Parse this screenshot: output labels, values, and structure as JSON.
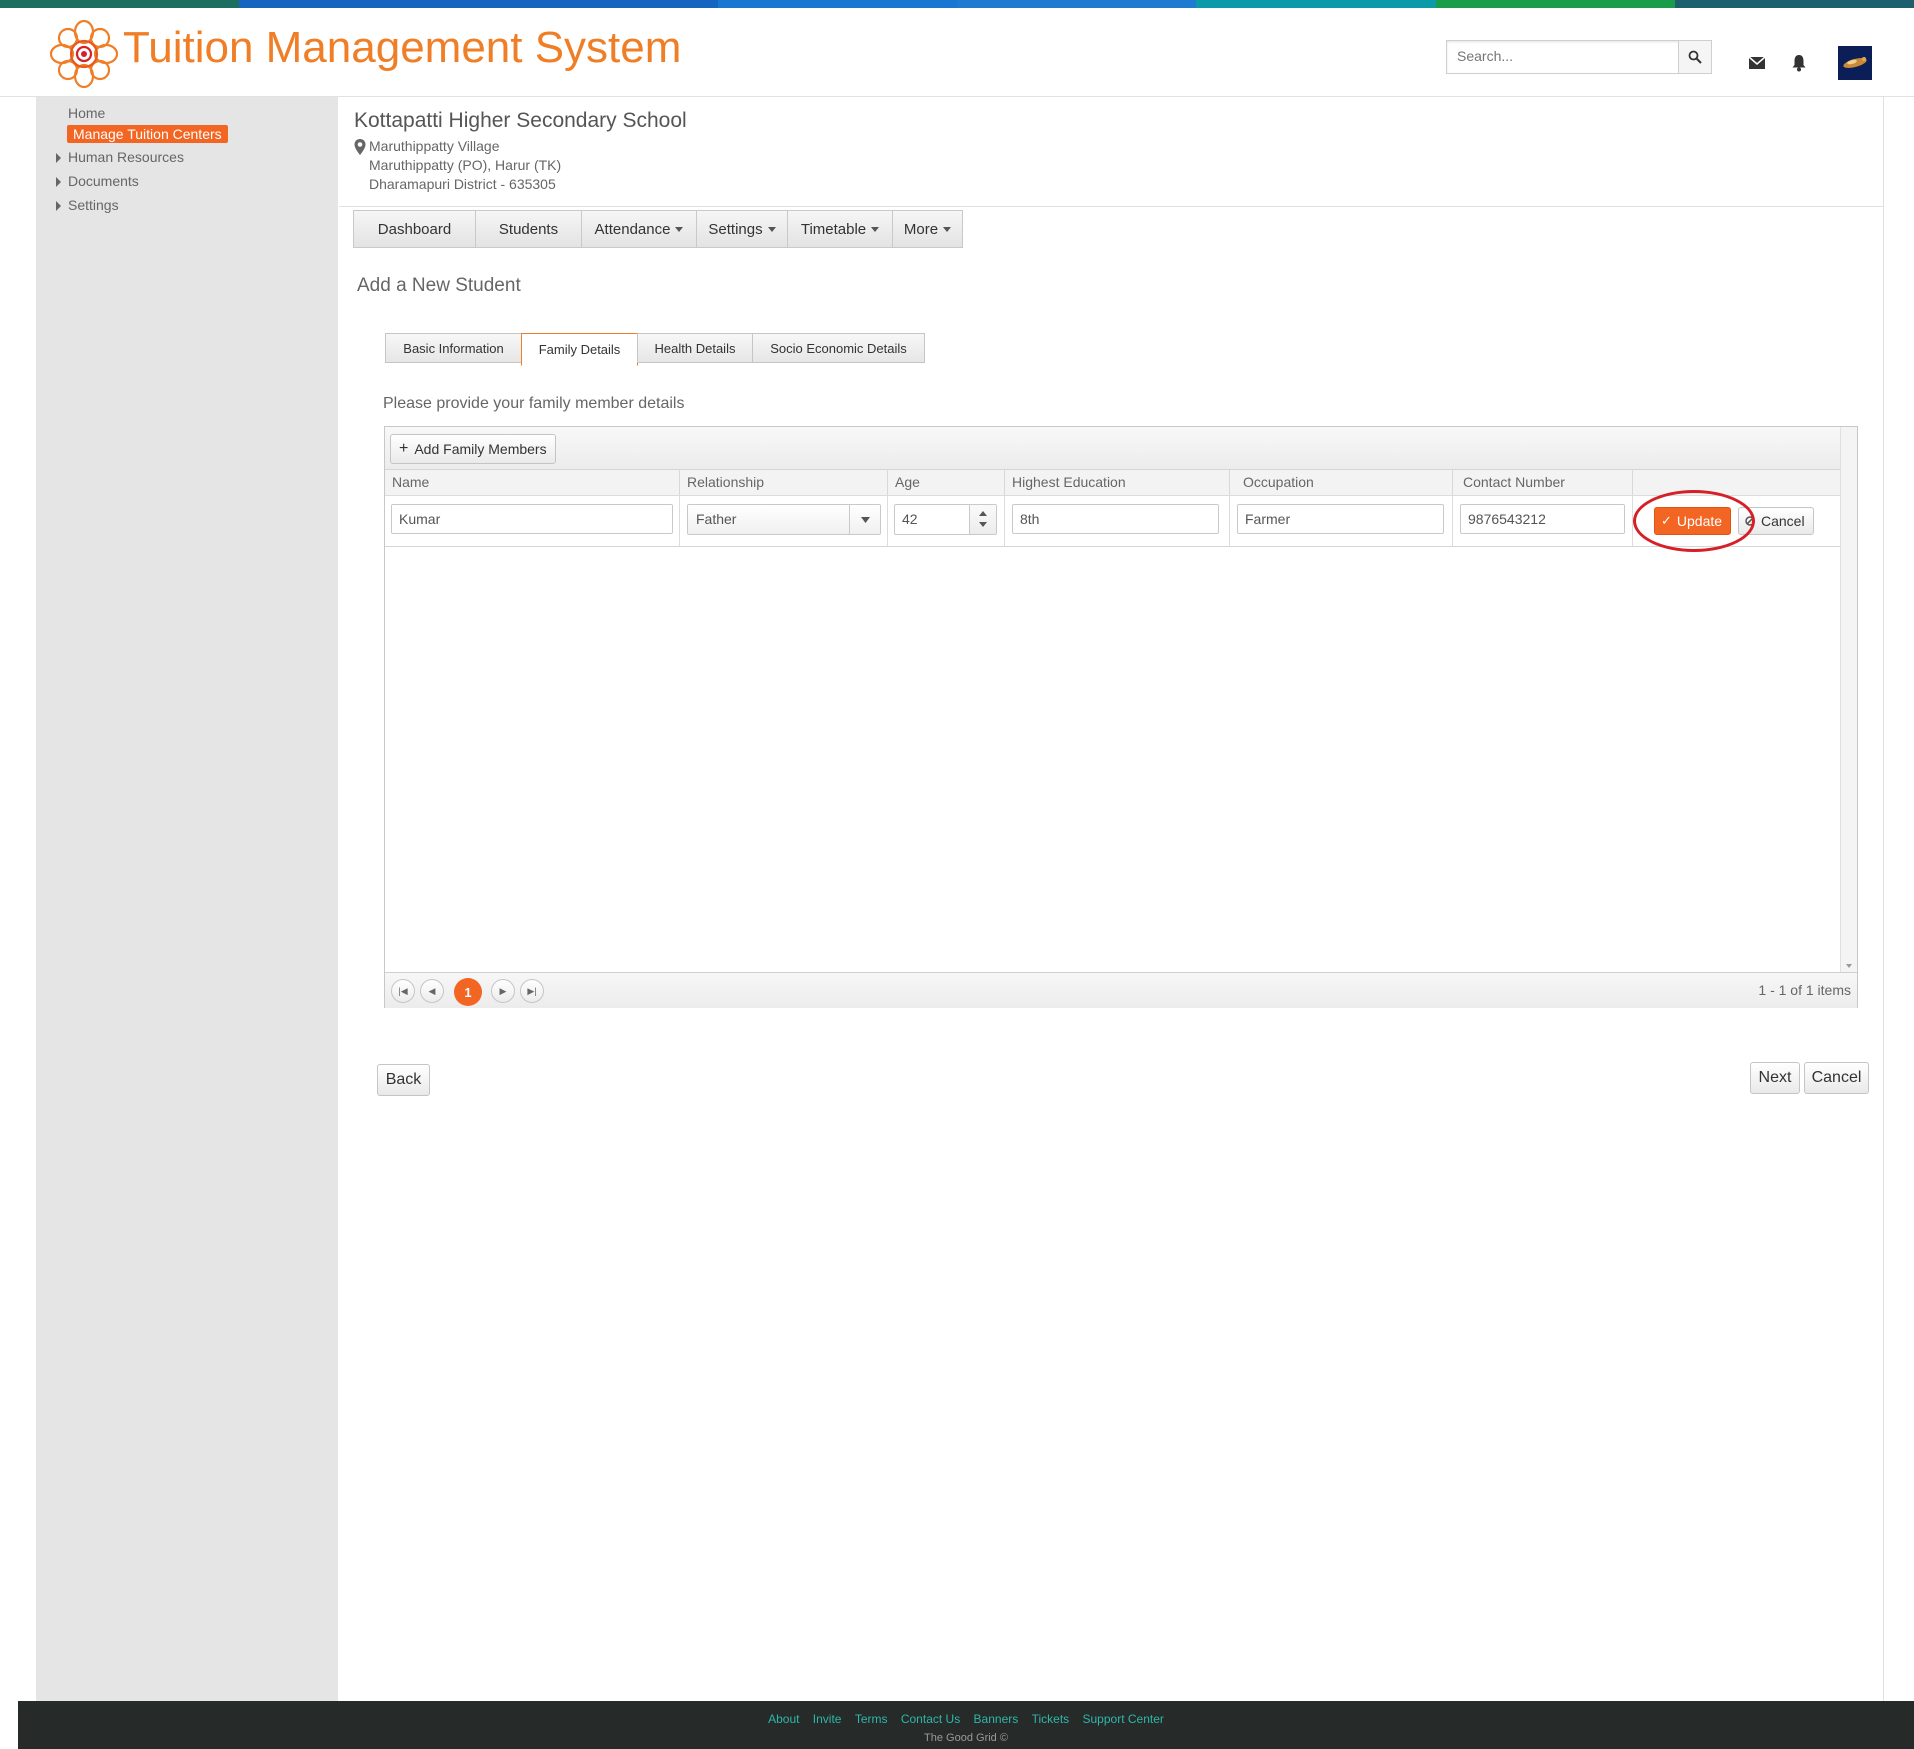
{
  "colors": {
    "accent": "#f26522",
    "title": "#f07e26",
    "stripe": [
      "#1b6e60",
      "#1565c0",
      "#1565c0",
      "#1976d2",
      "#1f7bd0",
      "#0c9aa8",
      "#1a9d4a",
      "#1d5f6e"
    ]
  },
  "header": {
    "app_title": "Tuition Management System",
    "search_placeholder": "Search...",
    "icons": [
      "search-icon",
      "mail-icon",
      "bell-icon",
      "avatar"
    ]
  },
  "sidebar": {
    "items": [
      {
        "label": "Home",
        "expandable": false,
        "active": false
      },
      {
        "label": "Manage Tuition  Centers",
        "expandable": false,
        "active": true
      },
      {
        "label": "Human Resources",
        "expandable": true,
        "active": false
      },
      {
        "label": "Documents",
        "expandable": true,
        "active": false
      },
      {
        "label": "Settings",
        "expandable": true,
        "active": false
      }
    ]
  },
  "school": {
    "name": "Kottapatti Higher Secondary School",
    "address": [
      "Maruthippatty Village",
      "Maruthippatty (PO), Harur (TK)",
      "Dharamapuri District - 635305"
    ]
  },
  "nav": {
    "items": [
      {
        "label": "Dashboard",
        "dropdown": false
      },
      {
        "label": "Students",
        "dropdown": false
      },
      {
        "label": "Attendance",
        "dropdown": true
      },
      {
        "label": "Settings",
        "dropdown": true
      },
      {
        "label": "Timetable",
        "dropdown": true
      },
      {
        "label": "More",
        "dropdown": true
      }
    ]
  },
  "page": {
    "heading": "Add a New Student",
    "instructions": "Please provide your family member details"
  },
  "tabs": [
    {
      "label": "Basic Information",
      "active": false
    },
    {
      "label": "Family Details",
      "active": true
    },
    {
      "label": "Health Details",
      "active": false
    },
    {
      "label": "Socio Economic Details",
      "active": false
    }
  ],
  "grid": {
    "add_button": "Add Family Members",
    "columns": [
      "Name",
      "Relationship",
      "Age",
      "Highest Education",
      "Occupation",
      "Contact Number"
    ],
    "row": {
      "name": "Kumar",
      "relationship": "Father",
      "age": "42",
      "education": "8th",
      "occupation": "Farmer",
      "contact": "9876543212"
    },
    "update_label": "Update",
    "cancel_label": "Cancel",
    "pager": {
      "current_page": "1",
      "info": "1 - 1 of 1 items"
    }
  },
  "actions": {
    "back": "Back",
    "next": "Next",
    "cancel": "Cancel"
  },
  "footer": {
    "links": [
      "About",
      "Invite",
      "Terms",
      "Contact Us",
      "Banners",
      "Tickets",
      "Support Center"
    ],
    "copyright": "The Good Grid ©"
  }
}
